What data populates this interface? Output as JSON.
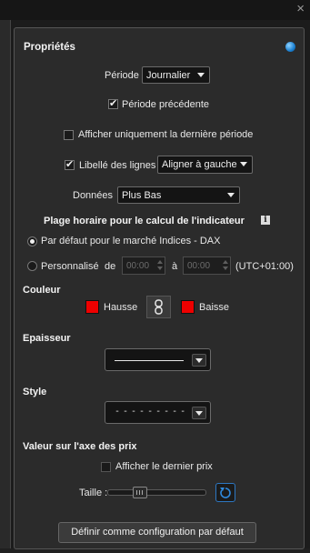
{
  "window": {
    "close_glyph": "×"
  },
  "panel": {
    "title": "Propriétés",
    "help_icon": "help-bubble-icon",
    "periode": {
      "label": "Période",
      "value": "Journalier"
    },
    "periode_precedente": {
      "label": "Période précédente",
      "checked": true
    },
    "derniere_periode": {
      "label": "Afficher uniquement la dernière période",
      "checked": false
    },
    "libelle": {
      "label": "Libellé des lignes",
      "checked": true,
      "value": "Aligner à gauche"
    },
    "donnees": {
      "label": "Données",
      "value": "Plus Bas"
    },
    "plage": {
      "title": "Plage horaire pour le calcul de l'indicateur",
      "info_glyph": "i",
      "default_option": "Par défaut pour le marché Indices - DAX",
      "custom_option": "Personnalisé",
      "from_label": "de",
      "from_value": "00:00",
      "to_label": "à",
      "to_value": "00:00",
      "timezone": "(UTC+01:00)"
    },
    "couleur": {
      "title": "Couleur",
      "up_label": "Hausse",
      "down_label": "Baisse",
      "up_color": "#ee0000",
      "down_color": "#ee0000"
    },
    "epaisseur": {
      "title": "Epaisseur"
    },
    "style": {
      "title": "Style",
      "value": "---------"
    },
    "axe": {
      "title": "Valeur sur l'axe des prix",
      "last_price_label": "Afficher le dernier prix",
      "last_price_checked": false,
      "size_label": "Taille :",
      "size_level": 0.3
    },
    "default_button": "Définir comme configuration par défaut"
  }
}
